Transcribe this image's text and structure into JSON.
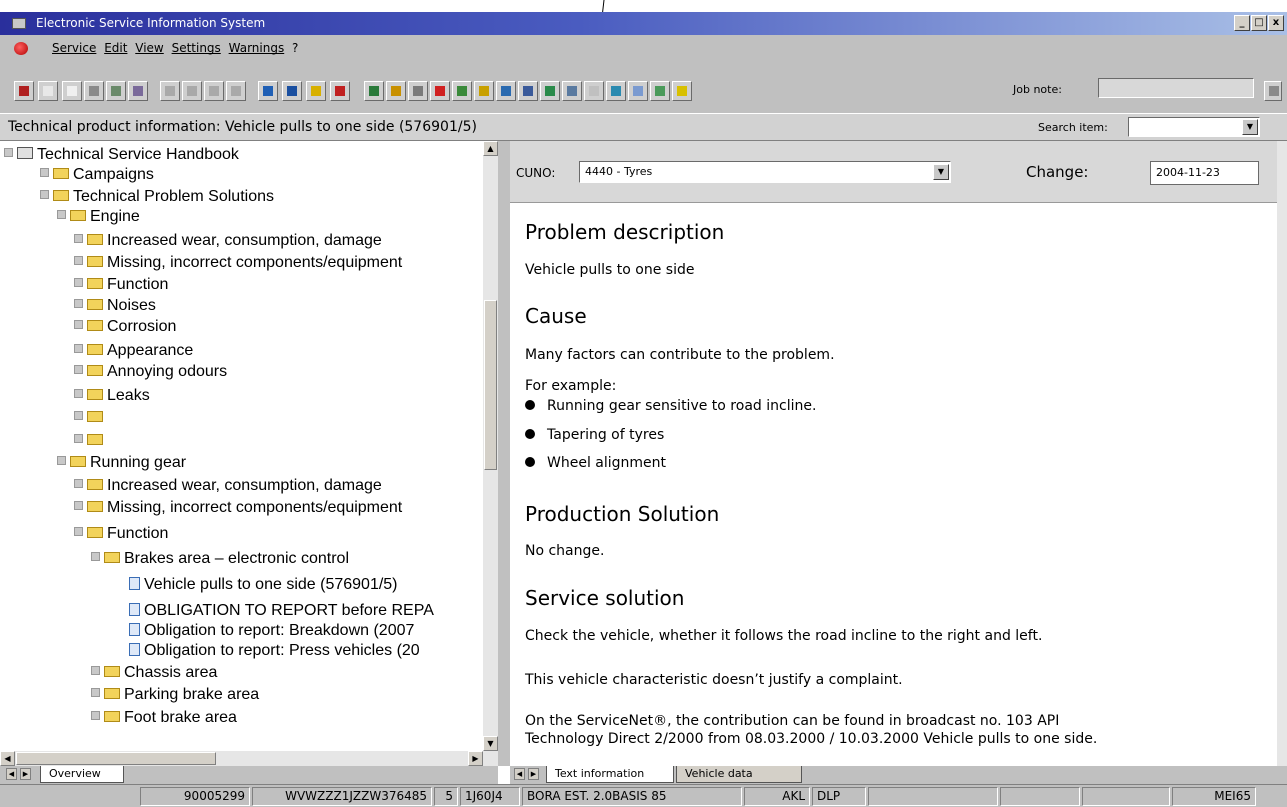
{
  "window": {
    "title": "Electronic Service Information System"
  },
  "menu": {
    "items": [
      "Service",
      "Edit",
      "View",
      "Settings",
      "Warnings",
      "?"
    ]
  },
  "toolbar": {
    "job_note_label": "Job note:",
    "job_note_value": ""
  },
  "info_bar": {
    "heading": "Technical product information: Vehicle pulls to one side (576901/5)",
    "search_label": "Search item:",
    "search_value": ""
  },
  "tree": {
    "root": "Technical Service Handbook",
    "campaigns": "Campaigns",
    "tps": "Technical Problem Solutions",
    "engine": "Engine",
    "engine_children": [
      "Increased wear, consumption, damage",
      "Missing, incorrect components/equipment",
      "Function",
      "Noises",
      "Corrosion",
      "Appearance",
      "Annoying odours",
      "Leaks",
      "",
      ""
    ],
    "running_gear": "Running gear",
    "rg_children": [
      "Increased wear, consumption, damage",
      "Missing, incorrect components/equipment",
      "Function"
    ],
    "brakes": "Brakes area – electronic control",
    "docs": [
      "Vehicle pulls to one side (576901/5)",
      "OBLIGATION TO REPORT before REPA",
      "Obligation to report: Breakdown (2007",
      "Obligation to report: Press vehicles (20"
    ],
    "other_areas": [
      "Chassis area",
      "Parking brake area",
      "Foot brake area"
    ]
  },
  "cuno": {
    "label": "CUNO:",
    "value": "4440 - Tyres",
    "change_label": "Change:",
    "change_value": "2004-11-23"
  },
  "content": {
    "problem_heading": "Problem description",
    "problem_text": "Vehicle pulls to one side",
    "cause_heading": "Cause",
    "cause_text": "Many factors can contribute to the problem.",
    "example_intro": "For example:",
    "bullets": [
      "Running gear sensitive to road incline.",
      "Tapering of tyres",
      "Wheel alignment"
    ],
    "production_heading": "Production Solution",
    "production_text": "No change.",
    "service_heading": "Service solution",
    "service_text_1": "Check the vehicle, whether it follows the road incline to the right and left.",
    "service_text_2": "This vehicle characteristic doesn’t justify a complaint.",
    "service_text_3a": "On the ServiceNet®, the contribution can be found in broadcast no. 103 API",
    "service_text_3b": "Technology Direct 2/2000 from 08.03.2000 / 10.03.2000 Vehicle pulls to one side."
  },
  "tabs": {
    "left": [
      "Overview"
    ],
    "right": [
      "Text information",
      "Vehicle data"
    ]
  },
  "status_bar": [
    "90005299",
    "WVWZZZ1JZZW376485",
    "5",
    "1J60J4",
    "BORA EST. 2.0BASIS 85",
    "AKL",
    "DLP",
    "MEI65"
  ]
}
